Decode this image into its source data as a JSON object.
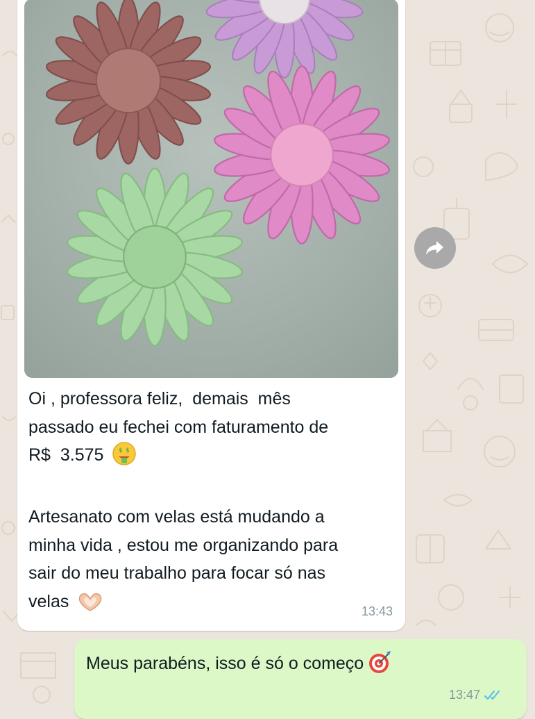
{
  "wallpaper": {
    "color": "#ece5dd",
    "doodle_color": "#ddd4c9"
  },
  "incoming_message": {
    "image_description_icon": "daisy-soap-photo",
    "text_line_1": "Oi , professora feliz,  demais  mês",
    "text_line_2": "passado eu fechei com faturamento de",
    "text_line_3": "R$  3.575",
    "text_line_5": "Artesanato com velas está mudando a",
    "text_line_6": "minha vida , estou me organizando para",
    "text_line_7": "sair do meu trabalho para focar só nas",
    "text_line_8": "velas",
    "emoji_1": "money-mouth-face",
    "emoji_2": "heart-hands",
    "time": "13:43"
  },
  "forward_button": {
    "icon": "forward-arrow-icon"
  },
  "outgoing_message": {
    "text": "Meus parabéns, isso é só o começo",
    "emoji": "direct-hit-target",
    "time": "13:47",
    "status_icon": "double-check-read-icon",
    "status_color": "#53bdeb",
    "bubble_color": "#dcf8c6"
  }
}
